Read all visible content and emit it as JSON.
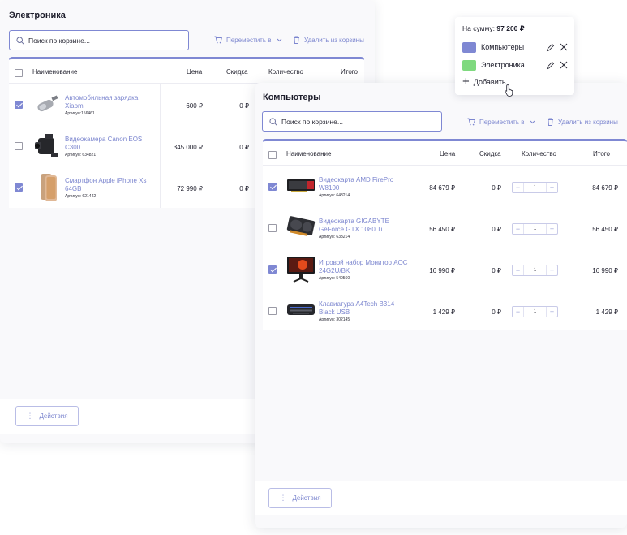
{
  "colors": {
    "accent": "#7f88d3",
    "link": "#7c86cf",
    "computers": "#7f88d3",
    "electronics": "#7fd97f"
  },
  "panel_electronics": {
    "title": "Электроника",
    "search_placeholder": "Поиск по корзине...",
    "move_label": "Переместить в",
    "remove_label": "Удалить из корзины",
    "columns": {
      "name": "Наименование",
      "price": "Цена",
      "discount": "Скидка",
      "qty": "Количество",
      "total": "Итого"
    },
    "rows": [
      {
        "name": "Автомобильная зарядка Xiaomi",
        "sku": "Артикул:156461",
        "price": "600 ₽",
        "discount": "0 ₽",
        "checked": true,
        "icon": "car-charger-icon"
      },
      {
        "name": "Видеокамера Canon EOS C300",
        "sku": "Артикул: 634821",
        "price": "345 000 ₽",
        "discount": "0 ₽",
        "checked": false,
        "icon": "video-camera-icon"
      },
      {
        "name": "Смартфон Apple iPhone Xs 64GB",
        "sku": "Артикул: 621442",
        "price": "72 990 ₽",
        "discount": "0 ₽",
        "checked": true,
        "icon": "smartphone-icon"
      }
    ],
    "actions_label": "Действия"
  },
  "panel_computers": {
    "title": "Компьютеры",
    "search_placeholder": "Поиск по корзине...",
    "move_label": "Переместить в",
    "remove_label": "Удалить из корзины",
    "columns": {
      "name": "Наименование",
      "price": "Цена",
      "discount": "Скидка",
      "qty": "Количество",
      "total": "Итого"
    },
    "rows": [
      {
        "name": "Видеокарта AMD FirePro W8100",
        "sku": "Артикул: 648214",
        "price": "84 679 ₽",
        "discount": "0 ₽",
        "qty": "1",
        "total": "84 679 ₽",
        "checked": true,
        "icon": "graphics-card-icon"
      },
      {
        "name": "Видеокарта GIGABYTE GeForce GTX 1080 Ti",
        "sku": "Артикул: 633214",
        "price": "56 450 ₽",
        "discount": "0 ₽",
        "qty": "1",
        "total": "56 450 ₽",
        "checked": false,
        "icon": "graphics-card-icon"
      },
      {
        "name": "Игровой набор Монитор AOC 24G2U/BK",
        "sku": "Артикул: 540560",
        "price": "16 990 ₽",
        "discount": "0 ₽",
        "qty": "1",
        "total": "16 990 ₽",
        "checked": true,
        "icon": "monitor-icon"
      },
      {
        "name": "Клавиатура A4Tech B314 Black USB",
        "sku": "Артикул: 302145",
        "price": "1 429 ₽",
        "discount": "0 ₽",
        "qty": "1",
        "total": "1 429 ₽",
        "checked": false,
        "icon": "keyboard-icon"
      }
    ],
    "actions_label": "Действия"
  },
  "popup": {
    "sum_label": "На сумму:",
    "sum_value": "97 200 ₽",
    "categories": [
      {
        "label": "Компьютеры",
        "color": "#7f88d3"
      },
      {
        "label": "Электроника",
        "color": "#7fd97f"
      }
    ],
    "add_label": "Добавить"
  }
}
